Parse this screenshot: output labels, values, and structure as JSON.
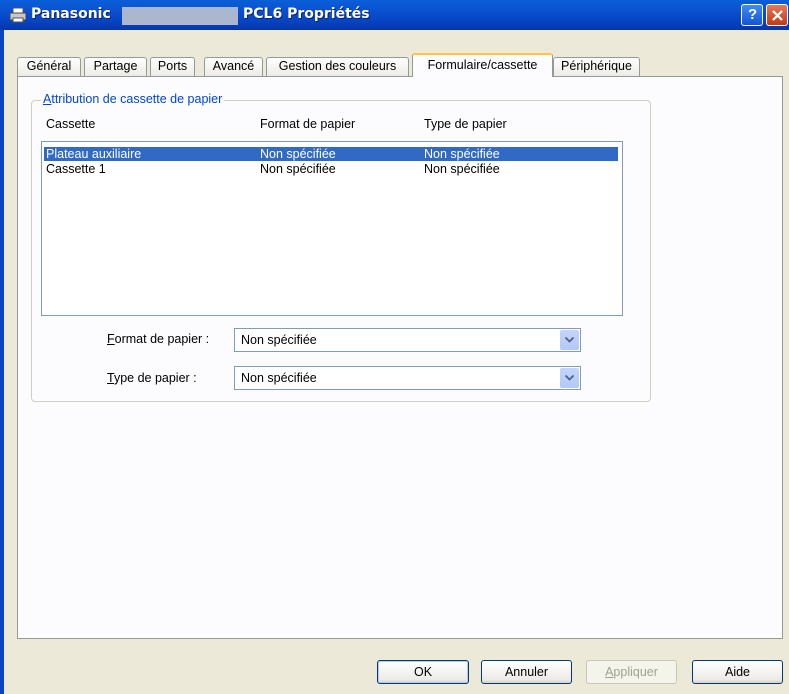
{
  "window": {
    "title_brand": "Panasonic",
    "title_suffix": "PCL6 Propriétés",
    "help_label": "?"
  },
  "tabs": [
    {
      "label": "Général",
      "active": false
    },
    {
      "label": "Partage",
      "active": false
    },
    {
      "label": "Ports",
      "active": false
    },
    {
      "label": "Avancé",
      "active": false
    },
    {
      "label": "Gestion des couleurs",
      "active": false
    },
    {
      "label": "Formulaire/cassette",
      "active": true
    },
    {
      "label": "Périphérique",
      "active": false
    }
  ],
  "group": {
    "legend": "Attribution de cassette de papier",
    "columns": [
      "Cassette",
      "Format de papier",
      "Type de papier"
    ],
    "rows": [
      {
        "cassette": "Plateau auxiliaire",
        "format": "Non spécifiée",
        "type": "Non spécifiée",
        "selected": true
      },
      {
        "cassette": "Cassette 1",
        "format": "Non spécifiée",
        "type": "Non spécifiée",
        "selected": false
      }
    ]
  },
  "fields": {
    "format_label": "Format de papier :",
    "format_value": "Non spécifiée",
    "type_label": "Type de papier :",
    "type_value": "Non spécifiée"
  },
  "buttons": {
    "ok": "OK",
    "cancel": "Annuler",
    "apply": "Appliquer",
    "help": "Aide"
  },
  "colors": {
    "titlebar": "#0a4fcf",
    "selection": "#316ac5",
    "active_tab_accent": "#ffc83c"
  }
}
